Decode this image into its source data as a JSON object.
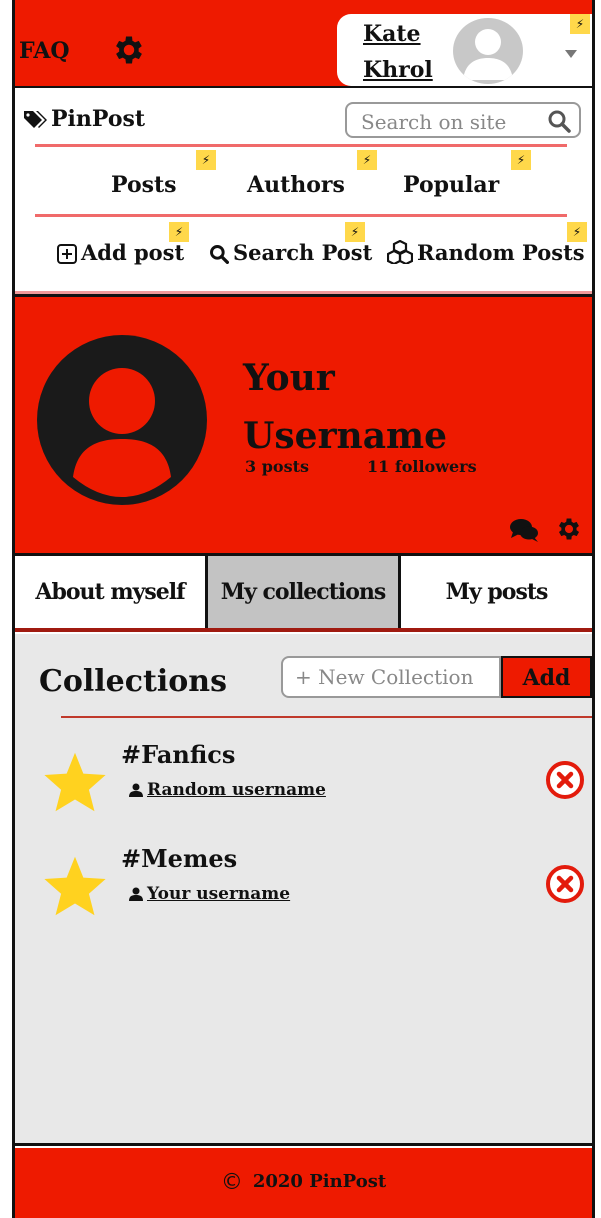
{
  "header": {
    "faq_label": "FAQ",
    "user_name": "Kate Khrol",
    "user_first": "Kate",
    "user_last": "Khrol"
  },
  "nav": {
    "logo_text": "PinPost",
    "search_placeholder": "Search on site",
    "links": [
      "Posts",
      "Authors",
      "Popular"
    ],
    "actions": [
      "Add post",
      "Search Post",
      "Random Posts"
    ]
  },
  "profile": {
    "name_line1": "Your",
    "name_line2": "Username",
    "posts": "3 posts",
    "followers": "11 followers"
  },
  "tabs": [
    "About myself",
    "My collections",
    "My posts"
  ],
  "active_tab": "My collections",
  "collections": {
    "title": "Collections",
    "new_placeholder": "+ New Collection",
    "add_label": "Add",
    "items": [
      {
        "name": "#Fanfics",
        "owner": "Random username"
      },
      {
        "name": "#Memes",
        "owner": "Your username"
      }
    ]
  },
  "footer": {
    "copyright_symbol": "©",
    "text": "2020 PinPost"
  },
  "colors": {
    "brand_red": "#ee1a00",
    "star_yellow": "#ffd21f",
    "accent_bolt": "#ffd84a"
  }
}
